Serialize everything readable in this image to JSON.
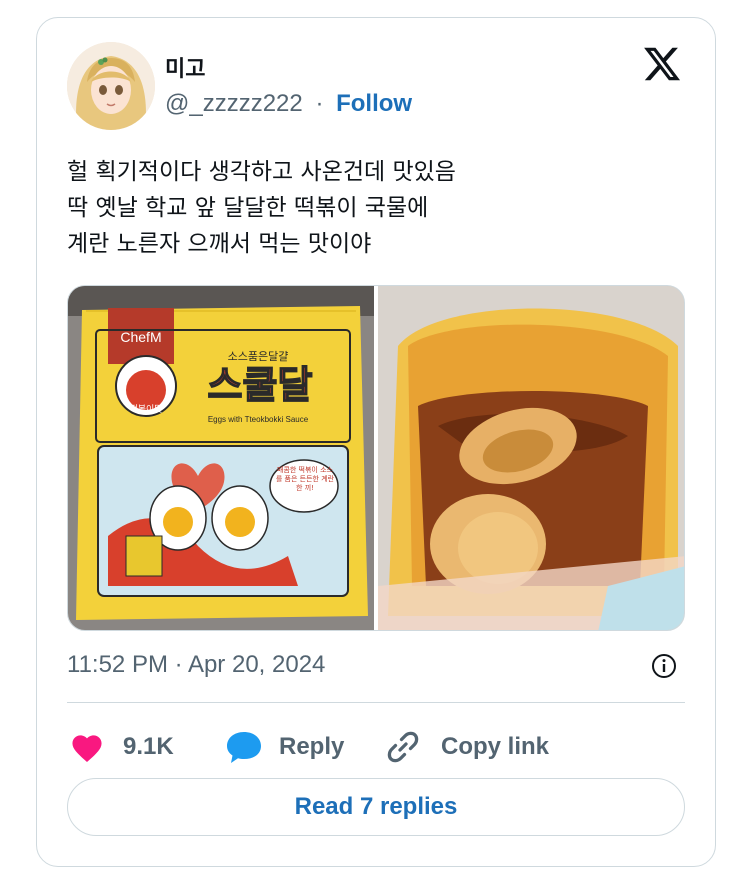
{
  "author": {
    "display_name": "미고",
    "handle": "@_zzzzz222",
    "separator": "·",
    "follow_label": "Follow"
  },
  "tweet": {
    "lines": [
      "헐 획기적이다 생각하고 사온건데 맛있음",
      "딱 옛날 학교 앞 달달한 떡볶이 국물에",
      "계란 노른자 으깨서 먹는 맛이야"
    ],
    "timestamp": "11:52 PM · Apr 20, 2024"
  },
  "media": {
    "photo1": {
      "brand": "ChefM",
      "product_name": "스쿨달",
      "tagline": "소스품은달걀",
      "subtitle": "Eggs with Tteokbokki Sauce",
      "badge": "떡볶이맛",
      "bubble": "매콤한 떡볶이 소스를 품은 든든한 계란 한 끼!"
    }
  },
  "actions": {
    "like_count": "9.1K",
    "reply_label": "Reply",
    "copy_label": "Copy link"
  },
  "read_replies_label": "Read 7 replies",
  "icons": {
    "like": "heart-icon",
    "reply": "speech-bubble-icon",
    "copy": "link-icon",
    "info": "info-icon",
    "brand": "x-logo-icon"
  },
  "colors": {
    "like": "#f91880",
    "reply": "#1d9bf0",
    "link": "#1d6fb8",
    "muted": "#536471",
    "border": "#cfd9de"
  }
}
